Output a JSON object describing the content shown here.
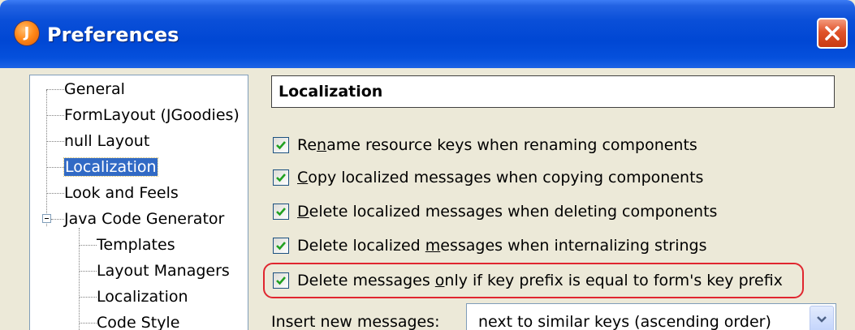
{
  "window": {
    "title": "Preferences",
    "app_icon_letter": "J"
  },
  "tree": {
    "items": [
      {
        "label": "General",
        "level": 0
      },
      {
        "label": "FormLayout (JGoodies)",
        "level": 0
      },
      {
        "label": "null Layout",
        "level": 0
      },
      {
        "label": "Localization",
        "level": 0,
        "selected": true
      },
      {
        "label": "Look and Feels",
        "level": 0
      },
      {
        "label": "Java Code Generator",
        "level": 0,
        "expanded": true
      },
      {
        "label": "Templates",
        "level": 1
      },
      {
        "label": "Layout Managers",
        "level": 1
      },
      {
        "label": "Localization",
        "level": 1
      },
      {
        "label": "Code Style",
        "level": 1
      }
    ]
  },
  "panel": {
    "title": "Localization",
    "options": [
      {
        "pre": "Re",
        "mnemonic": "n",
        "post": "ame resource keys when renaming components",
        "checked": true
      },
      {
        "pre": "",
        "mnemonic": "C",
        "post": "opy localized messages when copying components",
        "checked": true
      },
      {
        "pre": "",
        "mnemonic": "D",
        "post": "elete localized messages when deleting components",
        "checked": true
      },
      {
        "pre": "Delete localized ",
        "mnemonic": "m",
        "post": "essages when internalizing strings",
        "checked": true
      },
      {
        "pre": "Delete messages ",
        "mnemonic": "o",
        "post": "nly if key prefix is equal to form's key prefix",
        "checked": true
      }
    ],
    "insert_label": "Insert new messages:",
    "insert_value": "next to similar keys (ascending order)"
  },
  "colors": {
    "titlebar": "#0047d4",
    "selection": "#316ac5",
    "highlight": "#e0262f",
    "check": "#21a121"
  }
}
